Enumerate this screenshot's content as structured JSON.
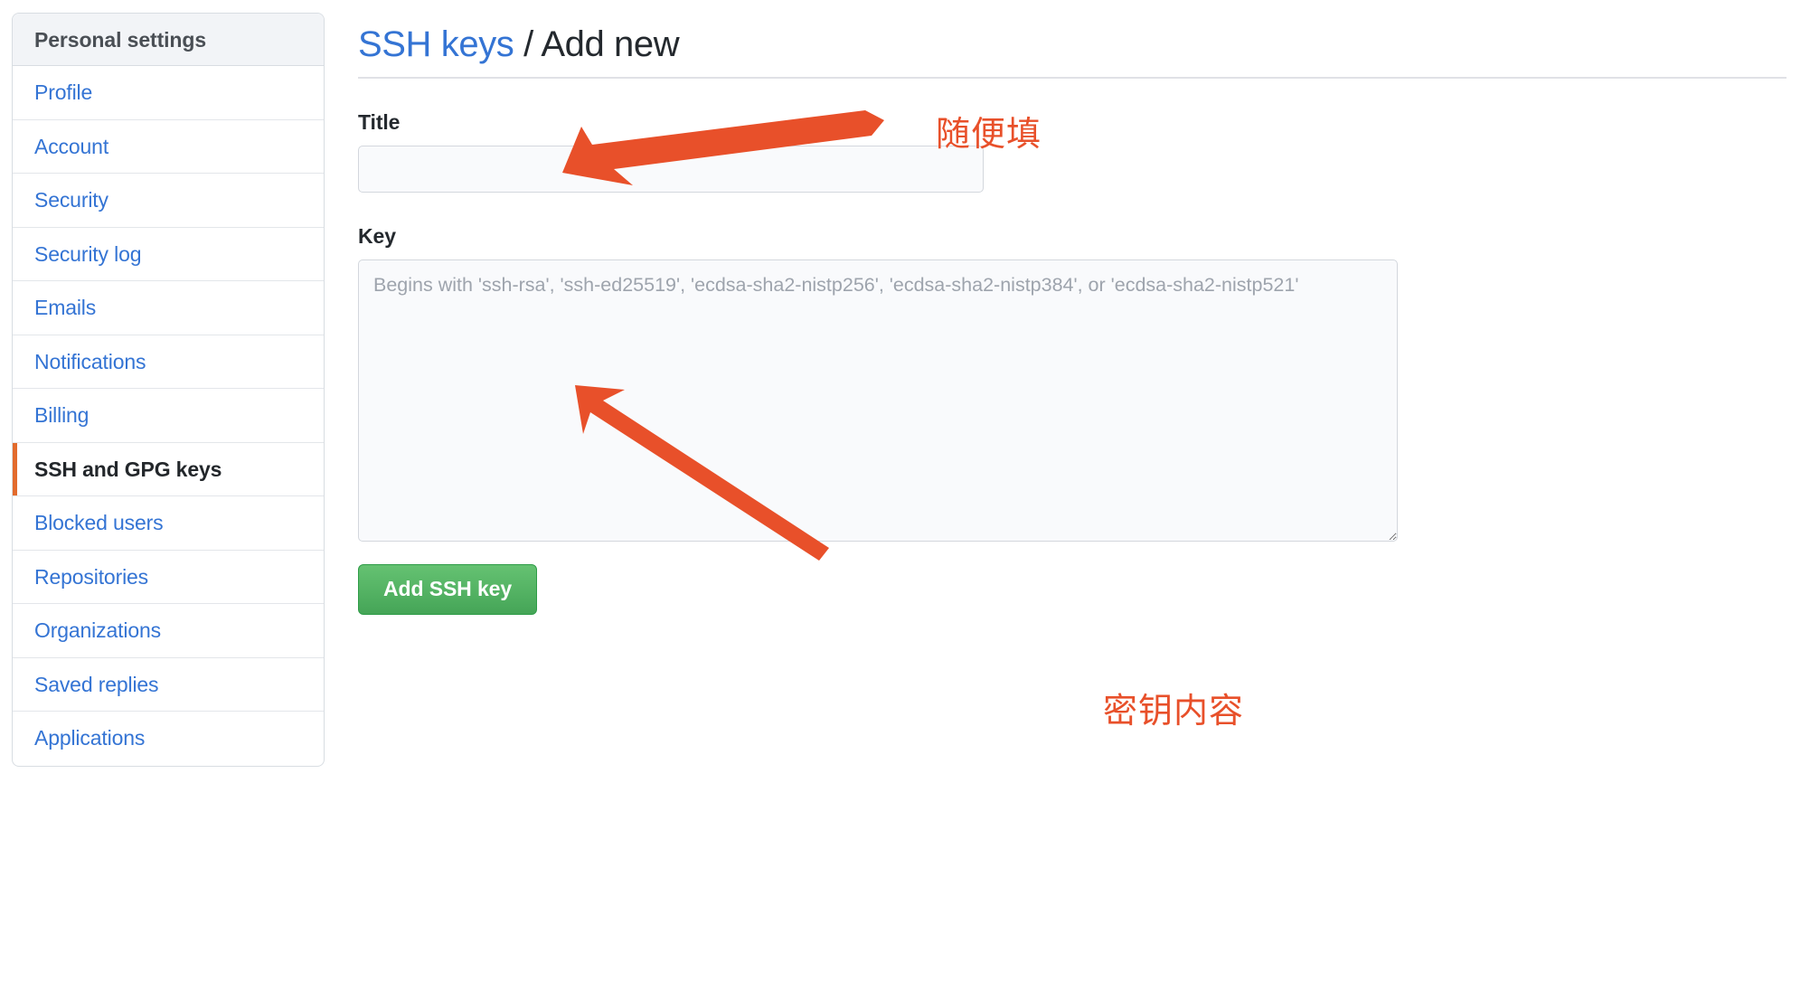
{
  "sidebar": {
    "header": "Personal settings",
    "items": [
      {
        "label": "Profile",
        "selected": false
      },
      {
        "label": "Account",
        "selected": false
      },
      {
        "label": "Security",
        "selected": false
      },
      {
        "label": "Security log",
        "selected": false
      },
      {
        "label": "Emails",
        "selected": false
      },
      {
        "label": "Notifications",
        "selected": false
      },
      {
        "label": "Billing",
        "selected": false
      },
      {
        "label": "SSH and GPG keys",
        "selected": true
      },
      {
        "label": "Blocked users",
        "selected": false
      },
      {
        "label": "Repositories",
        "selected": false
      },
      {
        "label": "Organizations",
        "selected": false
      },
      {
        "label": "Saved replies",
        "selected": false
      },
      {
        "label": "Applications",
        "selected": false
      }
    ]
  },
  "header": {
    "breadcrumb_link": "SSH keys",
    "breadcrumb_separator": " / ",
    "breadcrumb_current": "Add new"
  },
  "form": {
    "title_label": "Title",
    "title_value": "",
    "title_placeholder": "",
    "key_label": "Key",
    "key_value": "",
    "key_placeholder": "Begins with 'ssh-rsa', 'ssh-ed25519', 'ecdsa-sha2-nistp256', 'ecdsa-sha2-nistp384', or 'ecdsa-sha2-nistp521'",
    "submit_label": "Add SSH key"
  },
  "annotations": {
    "title_note": "随便填",
    "key_note": "密钥内容",
    "color": "#e8502a"
  },
  "colors": {
    "link": "#3474d4",
    "selected_marker": "#e26b2c",
    "button_green": "#45a557",
    "annotation_orange": "#e8502a",
    "field_bg": "#f9fafc",
    "border": "#d8dde2"
  }
}
